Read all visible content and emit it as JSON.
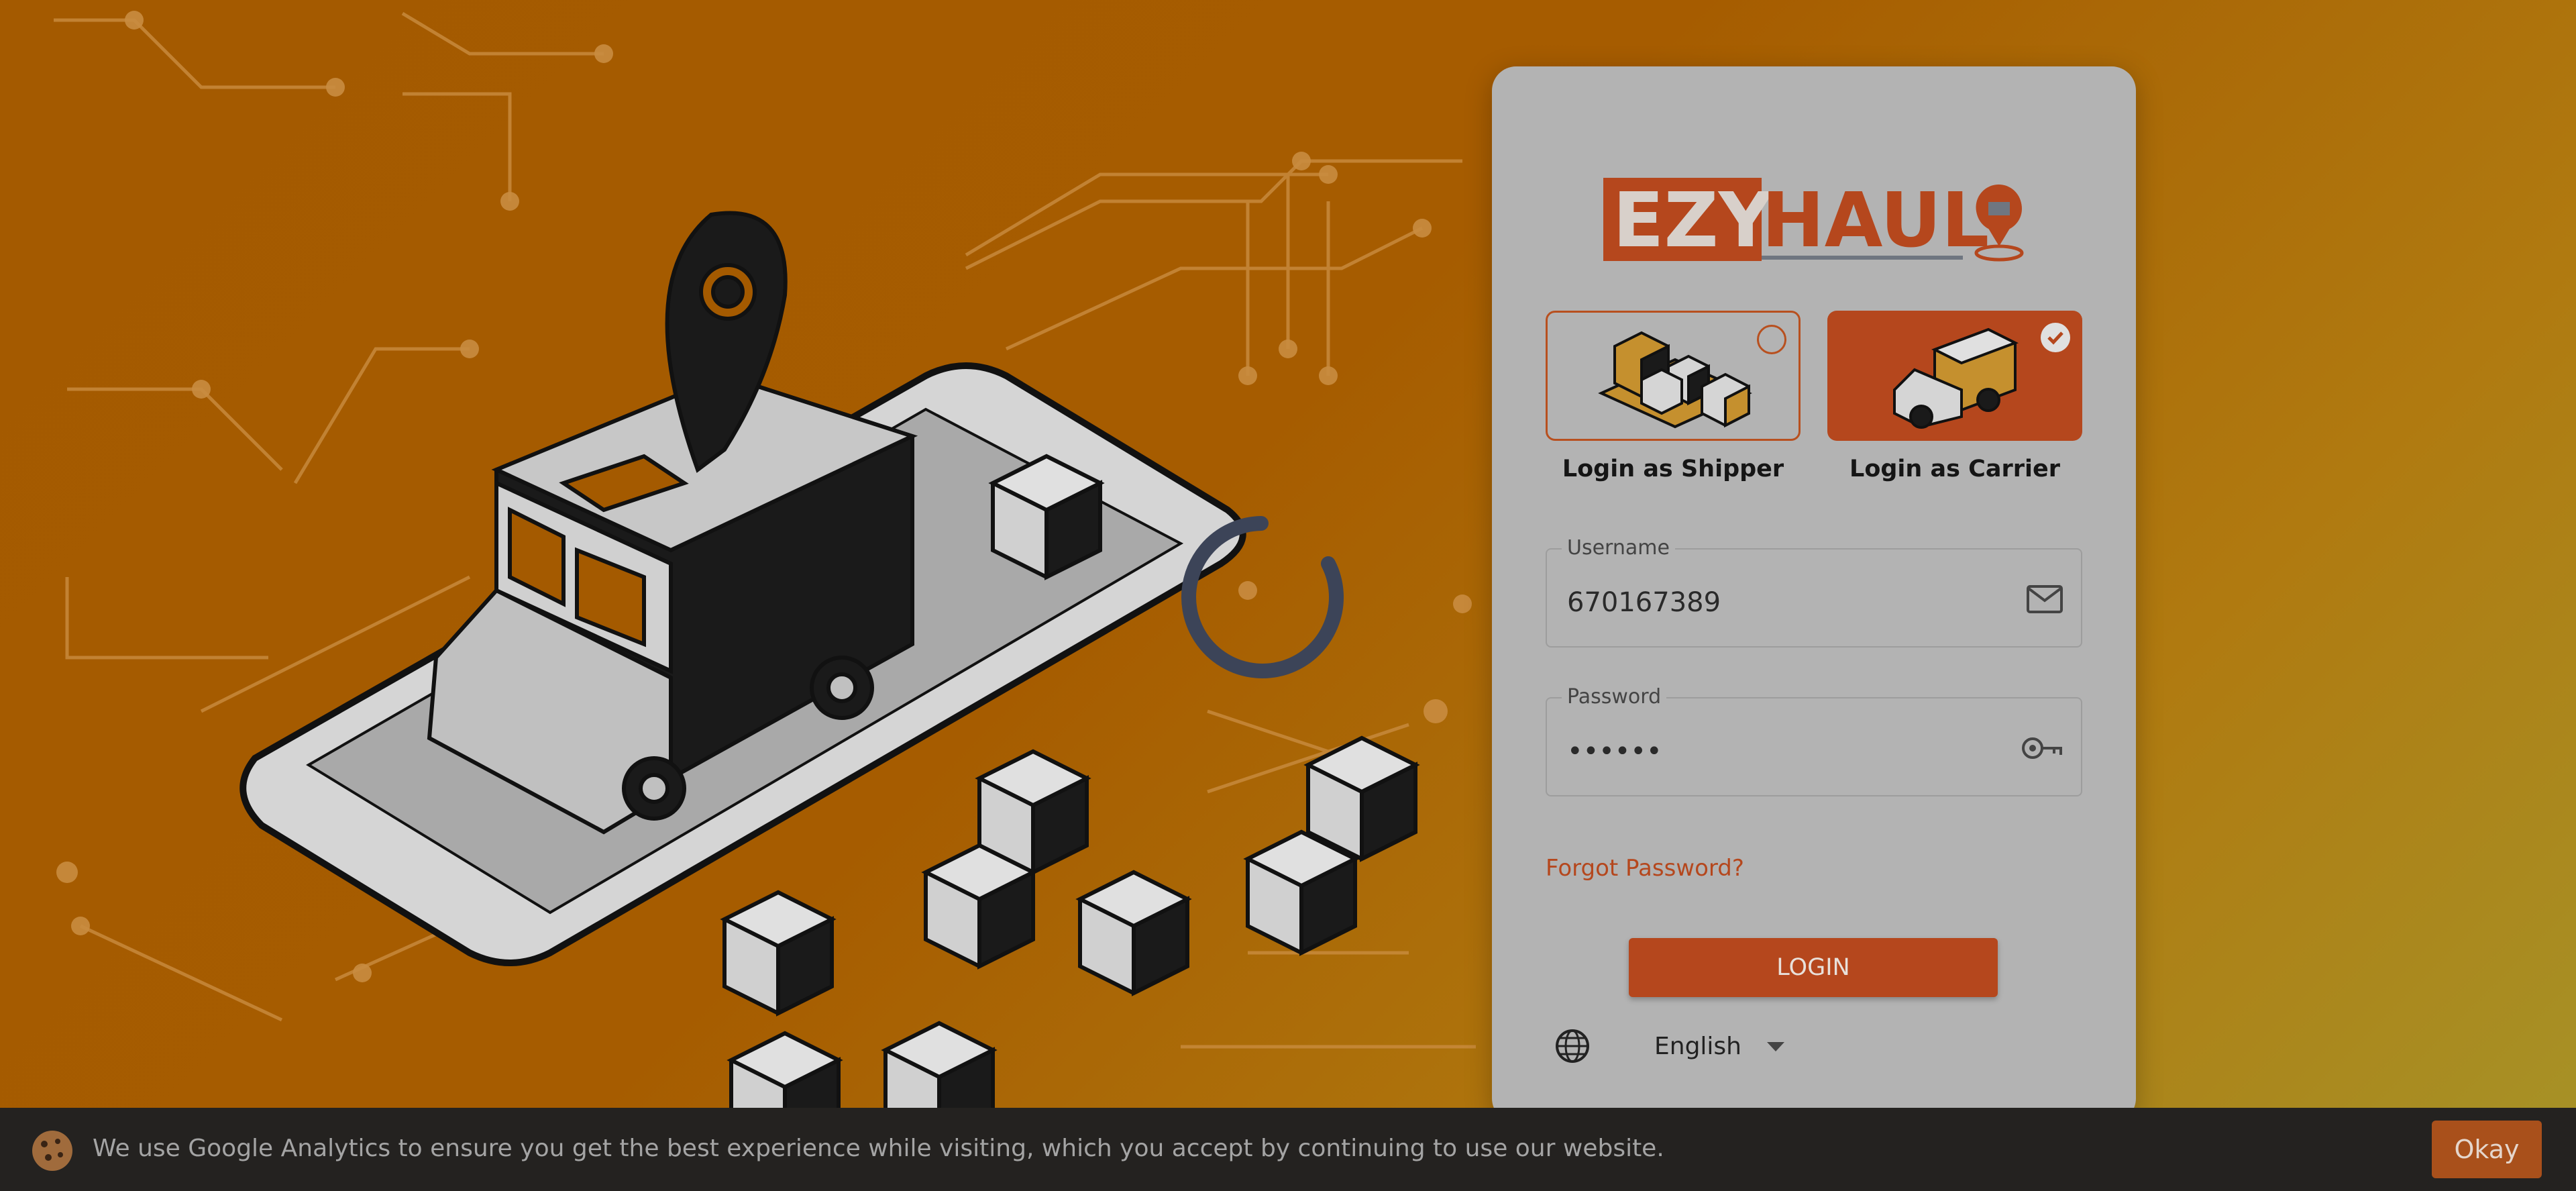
{
  "brand": {
    "part1": "EZY",
    "part2": "HAUL"
  },
  "roles": [
    {
      "label": "Login as Shipper",
      "selected": false
    },
    {
      "label": "Login as Carrier",
      "selected": true
    }
  ],
  "form": {
    "username_label": "Username",
    "username_value": "670167389",
    "password_label": "Password",
    "password_value": "••••••",
    "forgot_label": "Forgot Password?",
    "login_label": "LOGIN"
  },
  "language": {
    "selected": "English",
    "icon": "globe-icon"
  },
  "cookie": {
    "text": "We use Google Analytics to ensure you get the best experience while visiting, which you accept by continuing to use our website.",
    "button": "Okay",
    "icon": "cookie-icon"
  },
  "colors": {
    "accent": "#b5471d",
    "background": "#a45a00",
    "card": "#b3b3b3"
  }
}
